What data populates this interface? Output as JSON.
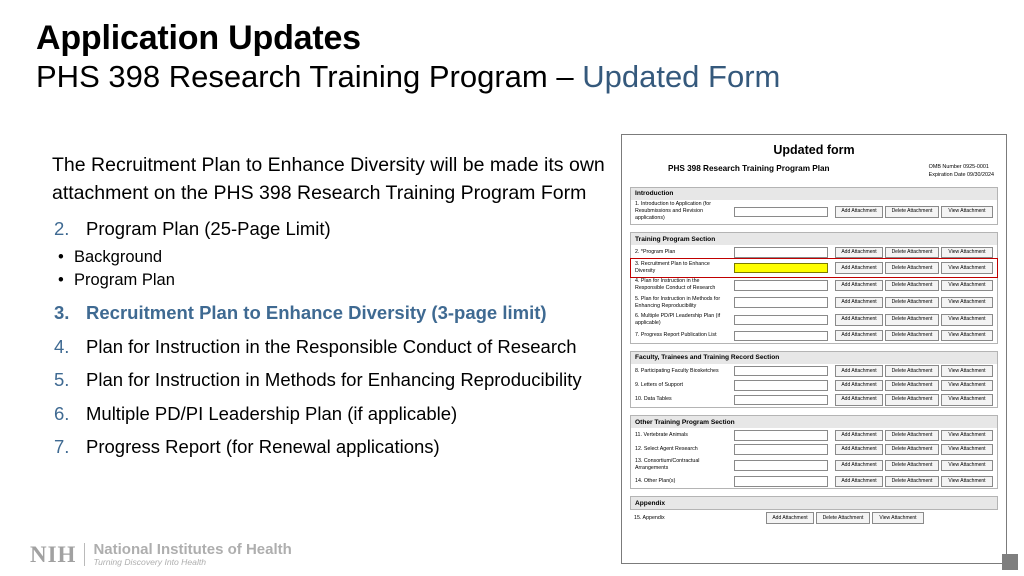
{
  "slide": {
    "title": "Application Updates",
    "subtitle_main": "PHS 398 Research Training Program – ",
    "subtitle_accent": "Updated Form"
  },
  "content": {
    "lead_paragraph": "The Recruitment Plan to Enhance Diversity will be made its own attachment on the PHS 398 Research Training Program Form",
    "items": [
      {
        "number": "2.",
        "text": "Program Plan (25-Page Limit)",
        "subitems": [
          "Background",
          "Program Plan"
        ],
        "highlight": false
      },
      {
        "number": "3.",
        "text": "Recruitment Plan to Enhance Diversity (3-page limit)",
        "subitems": [],
        "highlight": true
      },
      {
        "number": "4.",
        "text": "Plan for Instruction in the Responsible Conduct of Research",
        "subitems": [],
        "highlight": false
      },
      {
        "number": "5.",
        "text": "Plan for Instruction in Methods for Enhancing Reproducibility",
        "subitems": [],
        "highlight": false
      },
      {
        "number": "6.",
        "text": "Multiple PD/PI Leadership Plan (if applicable)",
        "subitems": [],
        "highlight": false
      },
      {
        "number": "7.",
        "text": "Progress Report (for Renewal applications)",
        "subitems": [],
        "highlight": false
      }
    ],
    "bullet_glyph": "•"
  },
  "form": {
    "title": "Updated form",
    "form_name": "PHS 398 Research Training Program Plan",
    "omb_number": "OMB Number 0925-0001",
    "expiration": "Expiration Date 09/30/2024",
    "buttons": {
      "add": "Add Attachment",
      "delete": "Delete Attachment",
      "view": "View Attachment"
    },
    "sections": [
      {
        "heading": "Introduction",
        "rows": [
          {
            "label": "1. Introduction to Application\n(for Resubmissions and\nRevision applications)",
            "field": "empty",
            "highlighted": false
          }
        ]
      },
      {
        "heading": "Training Program Section",
        "rows": [
          {
            "label": "2. *Program Plan",
            "field": "empty",
            "highlighted": false
          },
          {
            "label": "3. Recruitment Plan to Enhance Diversity",
            "field": "yellow",
            "highlighted": true
          },
          {
            "label": "4. Plan for Instruction in the Responsible Conduct of Research",
            "field": "empty",
            "highlighted": false
          },
          {
            "label": "5. Plan for Instruction in Methods for Enhancing Reproducibility",
            "field": "empty",
            "highlighted": false
          },
          {
            "label": "6. Multiple PD/PI Leadership Plan (if applicable)",
            "field": "empty",
            "highlighted": false
          },
          {
            "label": "7. Progress Report Publication List",
            "field": "empty",
            "highlighted": false
          }
        ]
      },
      {
        "heading": "Faculty, Trainees and Training Record Section",
        "rows": [
          {
            "label": "8. Participating Faculty Biosketches",
            "field": "empty",
            "highlighted": false
          },
          {
            "label": "9. Letters of Support",
            "field": "empty",
            "highlighted": false
          },
          {
            "label": "10. Data Tables",
            "field": "empty",
            "highlighted": false
          }
        ]
      },
      {
        "heading": "Other Training Program Section",
        "rows": [
          {
            "label": "11. Vertebrate Animals",
            "field": "empty",
            "highlighted": false
          },
          {
            "label": "12. Select Agent Research",
            "field": "empty",
            "highlighted": false
          },
          {
            "label": "13. Consortium/Contractual Arrangements",
            "field": "empty",
            "highlighted": false
          },
          {
            "label": "14. Other Plan(s)",
            "field": "empty",
            "highlighted": false
          }
        ]
      },
      {
        "heading": "Appendix",
        "rows": [
          {
            "label": "15. Appendix",
            "field": "none",
            "highlighted": false
          }
        ]
      }
    ]
  },
  "footer": {
    "logo_mark": "NIH",
    "org_name": "National Institutes of Health",
    "tagline": "Turning Discovery Into Health"
  }
}
